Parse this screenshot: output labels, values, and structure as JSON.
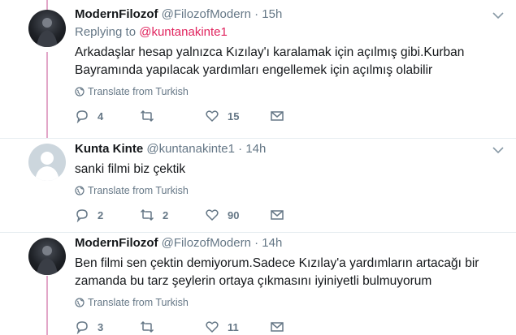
{
  "tweets": [
    {
      "name": "ModernFilozof",
      "handle": "@FilozofModern",
      "time": "15h",
      "replying_label": "Replying to",
      "replying_mention": "@kuntanakinte1",
      "text_line1": "Arkadaşlar hesap yalnızca Kızılay'ı karalamak için açılmış gibi.Kurban",
      "text_line2": "Bayramında yapılacak yardımları engellemek için açılmış olabilir",
      "translate": "Translate from Turkish",
      "replies": "4",
      "retweets": "",
      "likes": "15",
      "avatar": "dark-figure-avatar"
    },
    {
      "name": "Kunta Kinte",
      "handle": "@kuntanakinte1",
      "time": "14h",
      "text_line1": "sanki filmi biz çektik",
      "translate": "Translate from Turkish",
      "replies": "2",
      "retweets": "2",
      "likes": "90",
      "avatar": "default-egg-avatar"
    },
    {
      "name": "ModernFilozof",
      "handle": "@FilozofModern",
      "time": "14h",
      "text_line1": "Ben filmi sen çektin demiyorum.Sadece Kızılay'a yardımların artacağı bir",
      "text_line2": "zamanda bu tarz şeylerin ortaya çıkmasını iyiniyetli bulmuyorum",
      "translate": "Translate from Turkish",
      "replies": "3",
      "retweets": "",
      "likes": "11",
      "avatar": "dark-figure-avatar"
    }
  ],
  "separator": "·",
  "colors": {
    "accent_mention": "#e0245e",
    "thread_line": "#e2a6c8",
    "muted": "#657786"
  }
}
